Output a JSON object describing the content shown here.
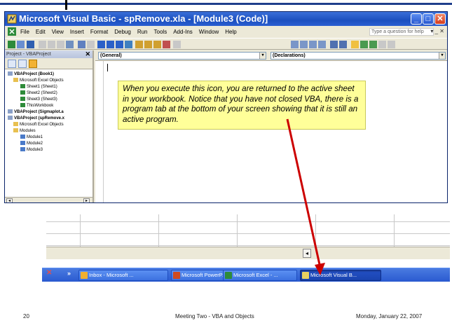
{
  "vba_window": {
    "title": "Microsoft Visual Basic - spRemove.xla - [Module3 (Code)]",
    "menu": [
      "File",
      "Edit",
      "View",
      "Insert",
      "Format",
      "Debug",
      "Run",
      "Tools",
      "Add-Ins",
      "Window",
      "Help"
    ],
    "help_placeholder": "Type a question for help",
    "project_title": "Project - VBAProject",
    "tree": [
      "VBAProject (Book1)",
      "Microsoft Excel Objects",
      "Sheet1 (Sheet1)",
      "Sheet2 (Sheet2)",
      "Sheet3 (Sheet3)",
      "ThisWorkbook",
      "VBAProject (Sigmaplot.a",
      "VBAProject (spRemove.x",
      "Microsoft Excel Objects",
      "Modules",
      "Module1",
      "Module2",
      "Module3"
    ],
    "combo_left": "(General)",
    "combo_right": "(Declarations)"
  },
  "callout": {
    "text": "When you execute this icon, you are returned to the active sheet in your workbook. Notice that you have not closed VBA, there is a program tab at the bottom of your screen showing that it is still an active program.",
    "color": "#ffff99"
  },
  "arrow_color": "#cc0000",
  "taskbar": {
    "items": [
      "Inbox - Microsoft ...",
      "Microsoft PowerP...",
      "Microsoft Excel - ...",
      "Microsoft Visual B..."
    ]
  },
  "footer": {
    "page_number": "20",
    "center": "Meeting Two - VBA and Objects",
    "date": "Monday, January 22, 2007"
  }
}
